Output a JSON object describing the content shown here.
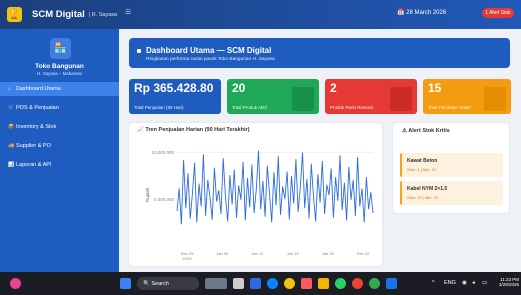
{
  "header": {
    "app_name": "SCM Digital",
    "app_sub": "| R. Sayasa",
    "menu_icon": "hamburger-icon",
    "date": "28 March 2026",
    "badge": "1 Alert Stok"
  },
  "sidebar": {
    "store_name": "Toko Bangunan",
    "store_sub": "H. Sayasa – Makassar",
    "items": [
      {
        "label": "Dashboard Utama",
        "icon": "home-icon"
      },
      {
        "label": "POS & Penjualan",
        "icon": "cart-icon"
      },
      {
        "label": "Inventory & Stok",
        "icon": "box-icon"
      },
      {
        "label": "Supplier & PO",
        "icon": "truck-icon"
      },
      {
        "label": "Laporan & API",
        "icon": "chart-icon"
      }
    ]
  },
  "page": {
    "title": "Dashboard Utama — SCM Digital",
    "subtitle": "Ringkasan performa rantai pasok Toko Bangunan H. Sayasa"
  },
  "stats": [
    {
      "value": "Rp 365.428.80",
      "label": "Total Penjualan (90 Hari)",
      "color": "#1e5dbf"
    },
    {
      "value": "20",
      "label": "Total Produk Aktif",
      "color": "#1fa855"
    },
    {
      "value": "2",
      "label": "Produk Perlu Restock",
      "color": "#e53935"
    },
    {
      "value": "15",
      "label": "Total Purchase Order",
      "color": "#f39c12"
    }
  ],
  "chart_title": "Tren Penjualan Harian (90 Hari Terakhir)",
  "alerts": {
    "title": "Alert Stok Kritis",
    "items": [
      {
        "name": "Kawat Beton",
        "status": "Stok: 4 | Min: 10"
      },
      {
        "name": "Kabel NYM 2×1.5",
        "status": "Stok: 15 | Min: 20"
      }
    ]
  },
  "taskbar": {
    "search_label": "Search",
    "lang": "ENG",
    "time": "11:23 PM",
    "date": "3/28/2026"
  },
  "chart_data": {
    "type": "line",
    "title": "Tren Penjualan Harian (90 Hari Terakhir)",
    "ylabel": "Rupiah",
    "xlabel": "",
    "ylim": [
      0,
      11000000
    ],
    "y_ticks": [
      5000000,
      10000000
    ],
    "y_tick_labels": [
      "5.000.000",
      "10.000.000"
    ],
    "x_tick_labels": [
      "Des 29\n2025",
      "Jan 05",
      "Jan 12",
      "Jan 19",
      "Jan 26",
      "Feb 02"
    ],
    "series": [
      {
        "name": "",
        "color": "#2d6cdf",
        "values": [
          3800000,
          6200000,
          2400000,
          9200000,
          4100000,
          7800000,
          3000000,
          5600000,
          8900000,
          2600000,
          6700000,
          4300000,
          9800000,
          3300000,
          7100000,
          5200000,
          2900000,
          8400000,
          4800000,
          6000000,
          3500000,
          9400000,
          5400000,
          2700000,
          7600000,
          4500000,
          8200000,
          3100000,
          6500000,
          5000000,
          9000000,
          2800000,
          7300000,
          4200000,
          8700000,
          3600000,
          6100000,
          10200000,
          4000000,
          7000000,
          3200000,
          8600000,
          5700000,
          2600000,
          7900000,
          4400000,
          9600000,
          3400000,
          6400000,
          5100000,
          8000000,
          2900000,
          7500000,
          4600000,
          9300000,
          3700000,
          6300000,
          10000000,
          4100000,
          7200000,
          3000000,
          8800000,
          5300000,
          2700000,
          7700000,
          4700000,
          9100000,
          3500000,
          6600000,
          5500000,
          8300000,
          3100000,
          7400000,
          4900000,
          9700000,
          3900000,
          6800000,
          2800000,
          8500000,
          5000000,
          7100000,
          3300000,
          9500000,
          4300000,
          6200000,
          2600000,
          7400000,
          4000000,
          5800000,
          3600000
        ]
      }
    ]
  }
}
